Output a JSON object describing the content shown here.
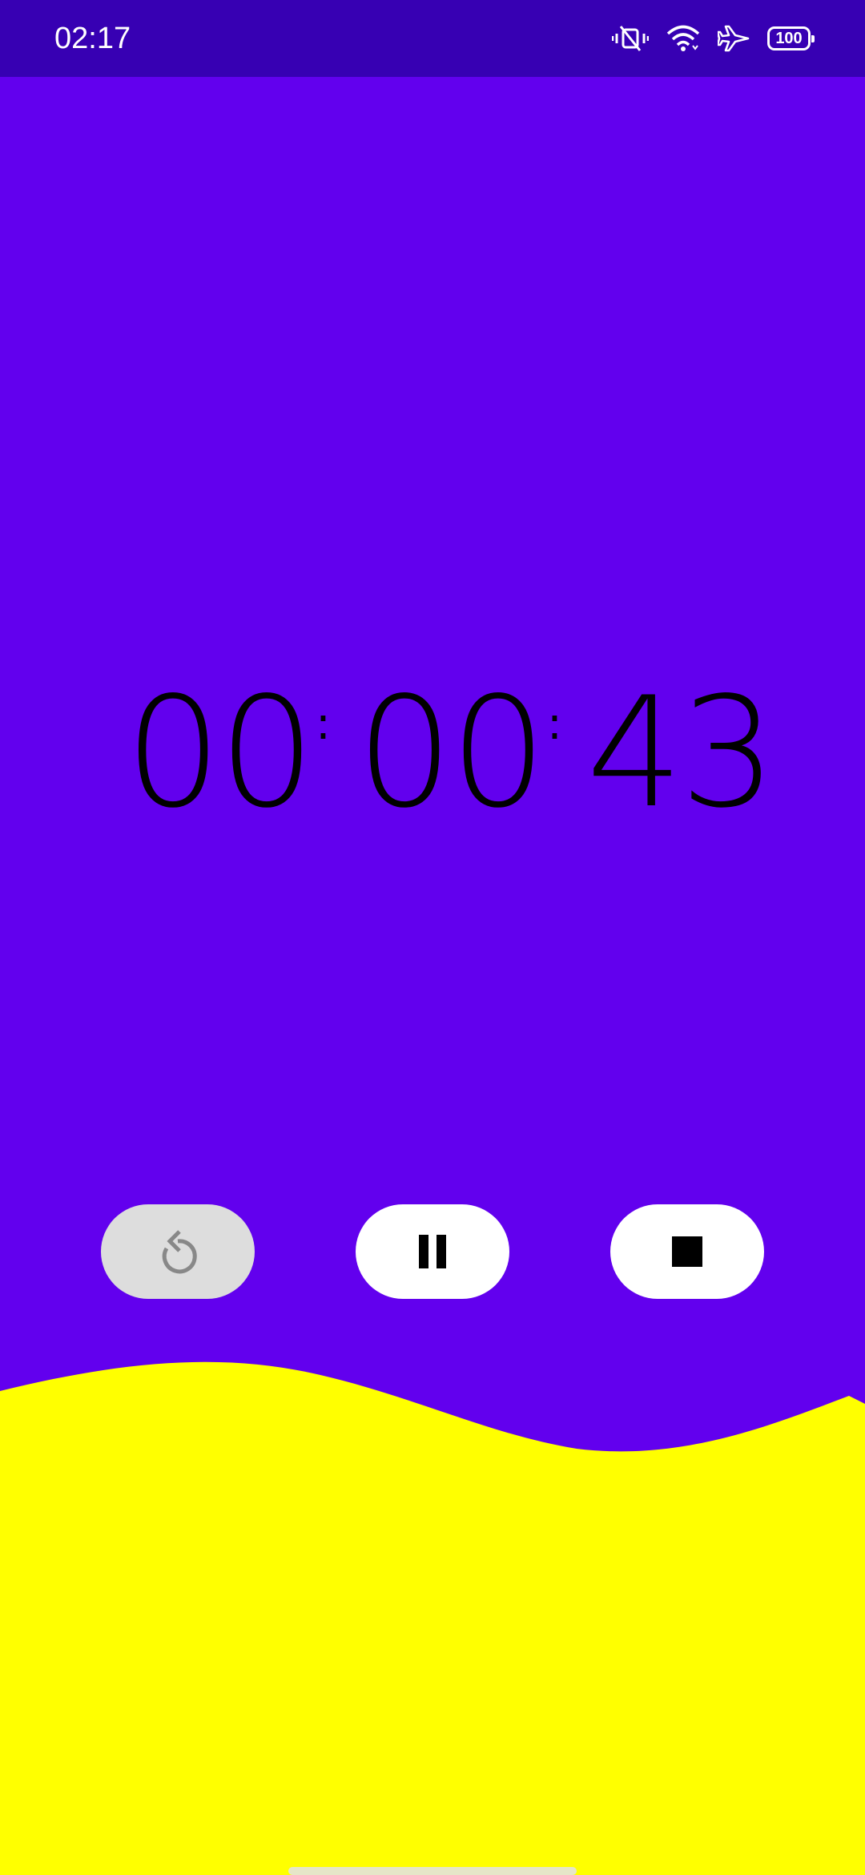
{
  "status_bar": {
    "time": "02:17",
    "battery": "100",
    "icons": [
      "vibrate-mute-icon",
      "wifi-icon",
      "airplane-mode-icon",
      "battery-icon"
    ]
  },
  "timer": {
    "hours": "00",
    "minutes": "00",
    "seconds": "43",
    "separator": ":"
  },
  "controls": {
    "reset_icon": "reset-icon",
    "reset_enabled": false,
    "pause_icon": "pause-icon",
    "stop_icon": "stop-icon"
  },
  "colors": {
    "background": "#6200EE",
    "status_bar": "#3700B3",
    "wave": "#FFFF00",
    "button": "#FFFFFF",
    "button_disabled": "#DDDDDD",
    "text": "#000000"
  }
}
